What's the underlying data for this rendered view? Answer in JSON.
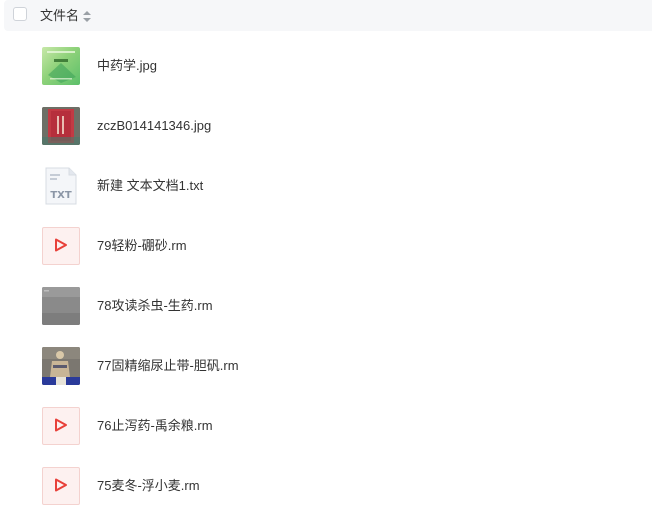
{
  "header": {
    "column_title": "文件名"
  },
  "files": [
    {
      "name": "中药学.jpg",
      "icon": "image-thumbnail-green-book-cover"
    },
    {
      "name": "zczB014141346.jpg",
      "icon": "image-thumbnail-red-book-cover"
    },
    {
      "name": "新建 文本文档1.txt",
      "icon": "txt-file-icon",
      "icon_label": "TXT"
    },
    {
      "name": "79轻粉-硼砂.rm",
      "icon": "video-play-icon"
    },
    {
      "name": "78攻读杀虫-生药.rm",
      "icon": "video-thumbnail-gray"
    },
    {
      "name": "77固精缩尿止带-胆矾.rm",
      "icon": "video-thumbnail-figure"
    },
    {
      "name": "76止泻药-禹余粮.rm",
      "icon": "video-play-icon"
    },
    {
      "name": "75麦冬-浮小麦.rm",
      "icon": "video-play-icon"
    }
  ],
  "colors": {
    "header_bg": "#f6f7f9",
    "video_icon_red": "#e8413a"
  }
}
